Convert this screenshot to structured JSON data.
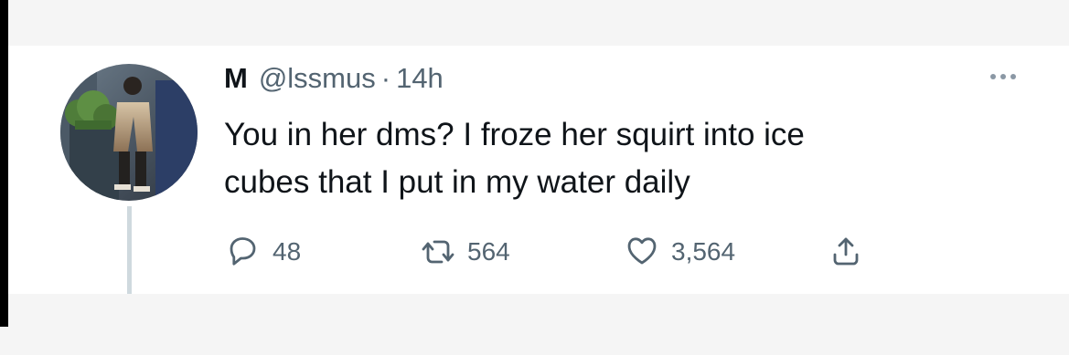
{
  "tweet": {
    "author": {
      "name": "M",
      "handle": "@lssmus",
      "separator": "·",
      "timestamp": "14h",
      "avatar": "avatar-photo"
    },
    "text": "You in her dms? I froze her squirt into ice\ncubes that I put in my water daily",
    "actions": {
      "reply": {
        "count": "48",
        "icon": "reply-icon"
      },
      "retweet": {
        "count": "564",
        "icon": "retweet-icon"
      },
      "like": {
        "count": "3,564",
        "icon": "heart-icon"
      },
      "share": {
        "icon": "share-icon"
      }
    },
    "more_icon": "more-options-icon"
  },
  "colors": {
    "text_primary": "#0f1419",
    "text_secondary": "#536471",
    "thread_line": "#cfd9de",
    "background": "#ffffff",
    "outer_background": "#f5f5f5"
  }
}
